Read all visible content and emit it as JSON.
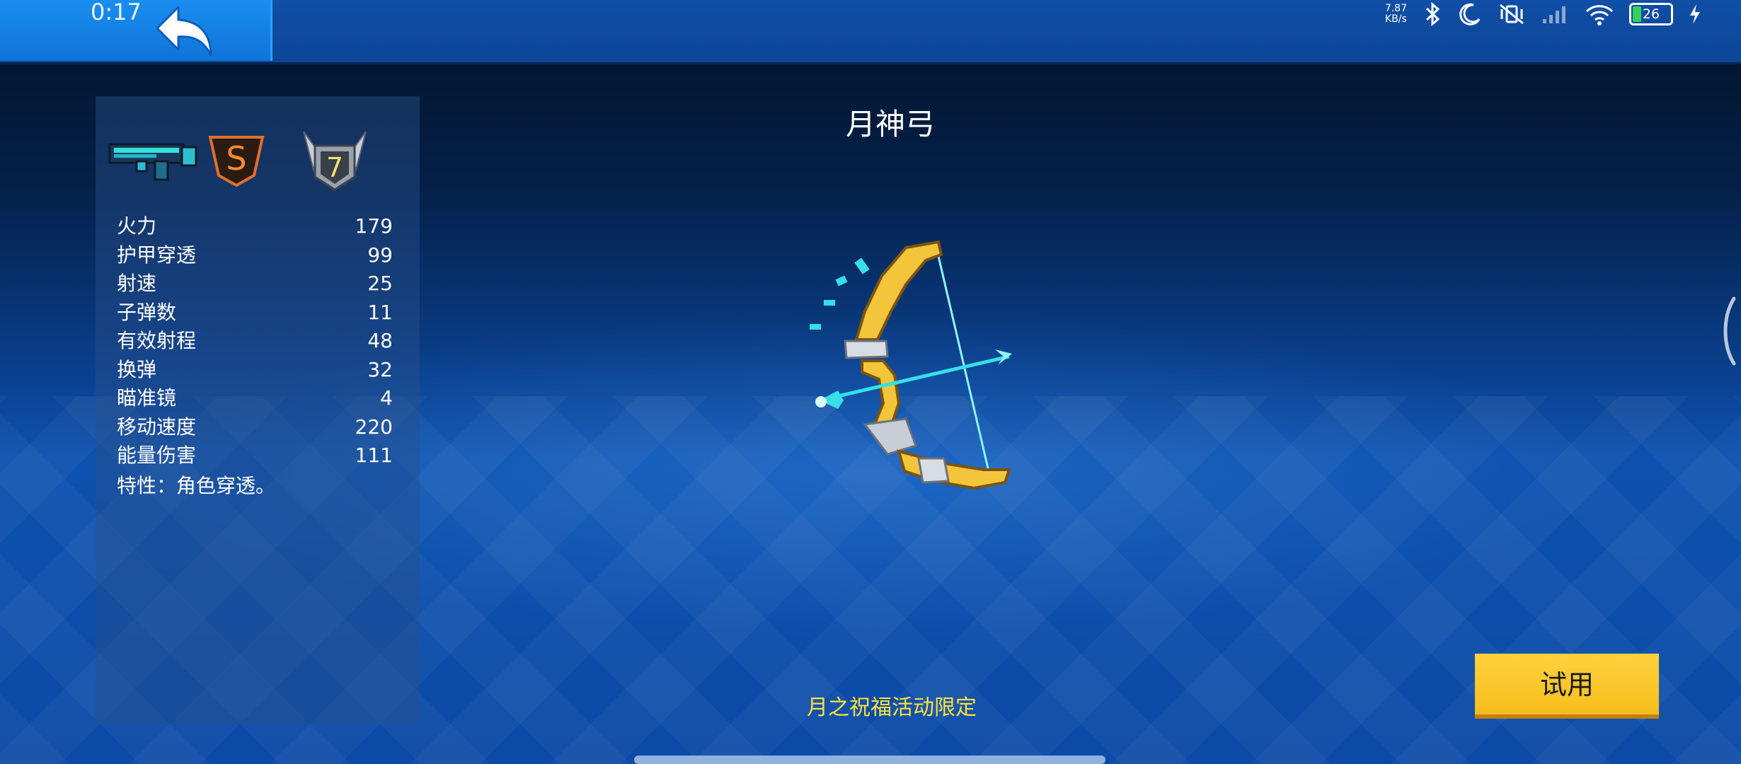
{
  "status_bar": {
    "time": "0:17",
    "net_speed_value": "7.87",
    "net_speed_unit": "KB/s",
    "battery_level": "26"
  },
  "weapon": {
    "name": "月神弓",
    "rank_badge": "S",
    "level_badge": "7",
    "event_label": "月之祝福活动限定"
  },
  "stats": [
    {
      "label": "火力",
      "value": "179"
    },
    {
      "label": "护甲穿透",
      "value": "99"
    },
    {
      "label": "射速",
      "value": "25"
    },
    {
      "label": "子弹数",
      "value": "11"
    },
    {
      "label": "有效射程",
      "value": "48"
    },
    {
      "label": "换弹",
      "value": "32"
    },
    {
      "label": "瞄准镜",
      "value": "4"
    },
    {
      "label": "移动速度",
      "value": "220"
    },
    {
      "label": "能量伤害",
      "value": "111"
    }
  ],
  "trait": "特性：角色穿透。",
  "buttons": {
    "try": "试用"
  },
  "icons": {
    "back": "back-arrow-icon",
    "weapon_category": "rifle-icon",
    "rank": "s-rank-badge-icon",
    "level": "winged-level-badge-icon",
    "status": [
      "bluetooth-icon",
      "moon-icon",
      "vibrate-off-icon",
      "signal-icon",
      "wifi-icon",
      "battery-icon",
      "charging-icon"
    ]
  },
  "colors": {
    "accent_blue": "#1a8df0",
    "event_yellow": "#ffe23a",
    "try_button": "#ffd23d"
  }
}
